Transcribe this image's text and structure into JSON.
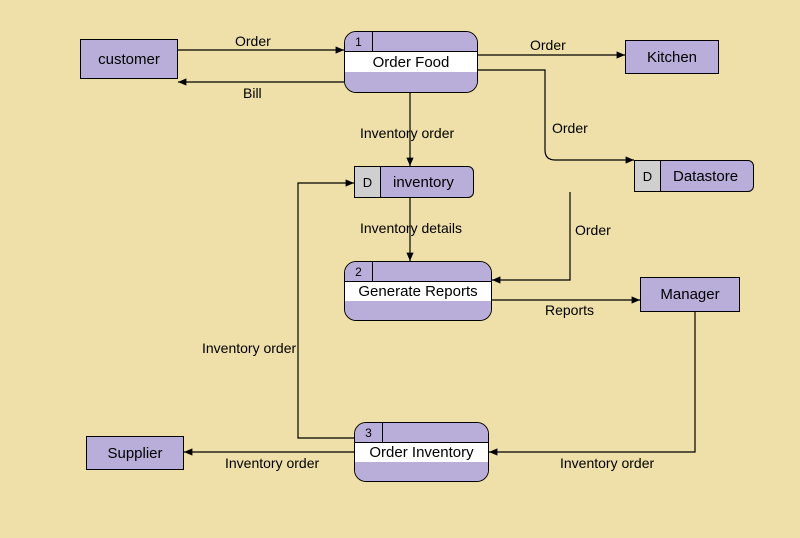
{
  "diagram": {
    "type": "data-flow-diagram",
    "entities": {
      "customer": "customer",
      "kitchen": "Kitchen",
      "manager": "Manager",
      "supplier": "Supplier"
    },
    "processes": {
      "p1": {
        "num": "1",
        "label": "Order Food"
      },
      "p2": {
        "num": "2",
        "label": "Generate Reports"
      },
      "p3": {
        "num": "3",
        "label": "Order Inventory"
      }
    },
    "datastores": {
      "inventory": {
        "tag": "D",
        "label": "inventory"
      },
      "orders": {
        "tag": "D",
        "label": "Datastore"
      }
    },
    "flows": {
      "cust_to_p1": "Order",
      "p1_to_cust": "Bill",
      "p1_to_kitchen": "Order",
      "p1_to_inv": "Inventory order",
      "p1_to_ds": "Order",
      "inv_to_p2": "Inventory details",
      "ds_to_p2": "Order",
      "p2_to_mgr": "Reports",
      "mgr_to_p3": "Inventory order",
      "p3_to_supp": "Inventory order",
      "p3_to_inv": "Inventory order"
    }
  }
}
